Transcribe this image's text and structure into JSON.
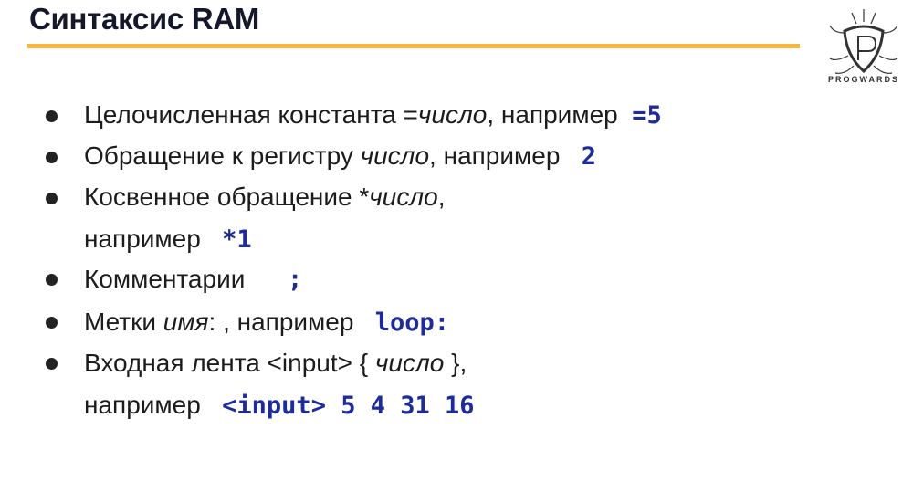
{
  "title": "Синтаксис RAM",
  "logo": {
    "name": "PROGWARDS"
  },
  "items": [
    {
      "text": "Целочисленная константа =",
      "em": "число",
      "rest": ", например",
      "code": "=5"
    },
    {
      "text": "Обращение к регистру ",
      "em": "число",
      "rest": ", например",
      "code": "2"
    },
    {
      "text": "Косвенное обращение *",
      "em": "число",
      "rest": ",",
      "line2": "например",
      "code": "*1"
    },
    {
      "text": "Комментарии",
      "code": ";"
    },
    {
      "text": "Метки ",
      "em": "имя",
      "rest": ": , например",
      "code": "loop:"
    },
    {
      "text": "Входная лента <input> { ",
      "em": "число",
      "rest": " },",
      "line2": "например",
      "code": "<input> 5 4 31 16"
    }
  ],
  "colors": {
    "accent": "#f4b740",
    "code": "#1e2c9a",
    "title": "#15172b"
  }
}
